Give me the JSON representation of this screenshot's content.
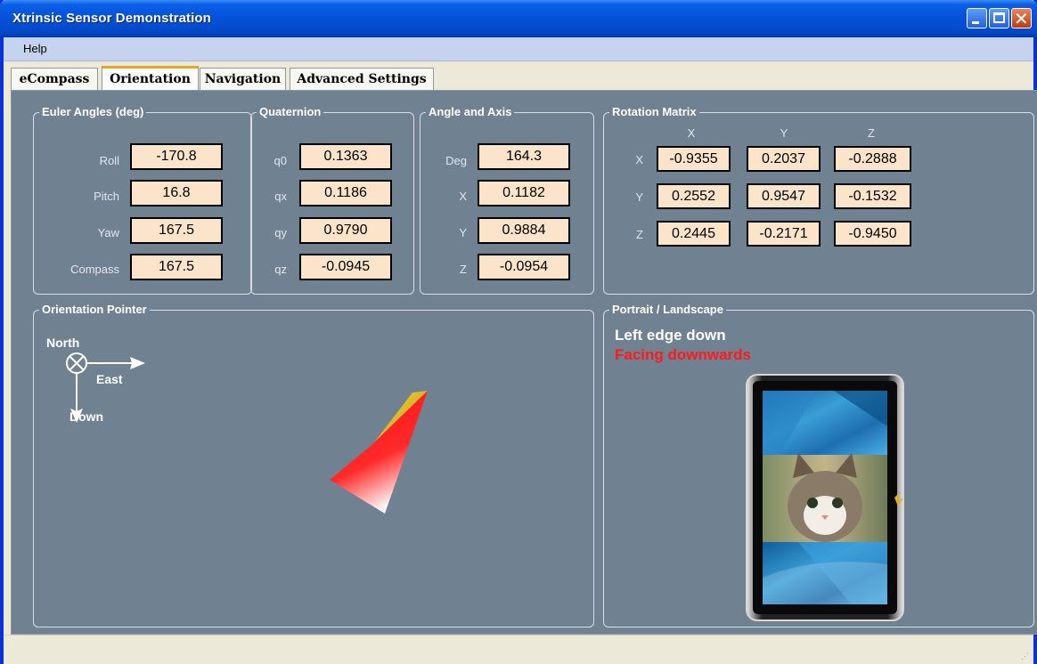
{
  "window": {
    "title": "Xtrinsic Sensor Demonstration"
  },
  "menu": {
    "help_label": "Help"
  },
  "tabs": [
    {
      "label": "eCompass"
    },
    {
      "label": "Orientation"
    },
    {
      "label": "Navigation"
    },
    {
      "label": "Advanced Settings"
    }
  ],
  "euler": {
    "title": "Euler Angles (deg)",
    "rows": [
      {
        "label": "Roll",
        "value": "-170.8"
      },
      {
        "label": "Pitch",
        "value": "16.8"
      },
      {
        "label": "Yaw",
        "value": "167.5"
      },
      {
        "label": "Compass",
        "value": "167.5"
      }
    ]
  },
  "quaternion": {
    "title": "Quaternion",
    "rows": [
      {
        "label": "q0",
        "value": "0.1363"
      },
      {
        "label": "qx",
        "value": "0.1186"
      },
      {
        "label": "qy",
        "value": "0.9790"
      },
      {
        "label": "qz",
        "value": "-0.0945"
      }
    ]
  },
  "angle_axis": {
    "title": "Angle and Axis",
    "rows": [
      {
        "label": "Deg",
        "value": "164.3"
      },
      {
        "label": "X",
        "value": "0.1182"
      },
      {
        "label": "Y",
        "value": "0.9884"
      },
      {
        "label": "Z",
        "value": "-0.0954"
      }
    ]
  },
  "rotation_matrix": {
    "title": "Rotation Matrix",
    "col_headers": [
      "X",
      "Y",
      "Z"
    ],
    "rows": [
      {
        "label": "X",
        "values": [
          "-0.9355",
          "0.2037",
          "-0.2888"
        ]
      },
      {
        "label": "Y",
        "values": [
          "0.2552",
          "0.9547",
          "-0.1532"
        ]
      },
      {
        "label": "Z",
        "values": [
          "0.2445",
          "-0.2171",
          "-0.9450"
        ]
      }
    ]
  },
  "orientation_pointer": {
    "title": "Orientation Pointer",
    "north_label": "North",
    "east_label": "East",
    "down_label": "Down"
  },
  "portrait_landscape": {
    "title": "Portrait / Landscape",
    "status_line1": "Left edge down",
    "status_line2": "Facing downwards",
    "status_line2_color": "#ff1a1a"
  },
  "colors": {
    "panel_bg": "#708191",
    "value_bg": "#fbe4c9",
    "titlebar": "#0551d8",
    "pointer": "#ff0000"
  }
}
